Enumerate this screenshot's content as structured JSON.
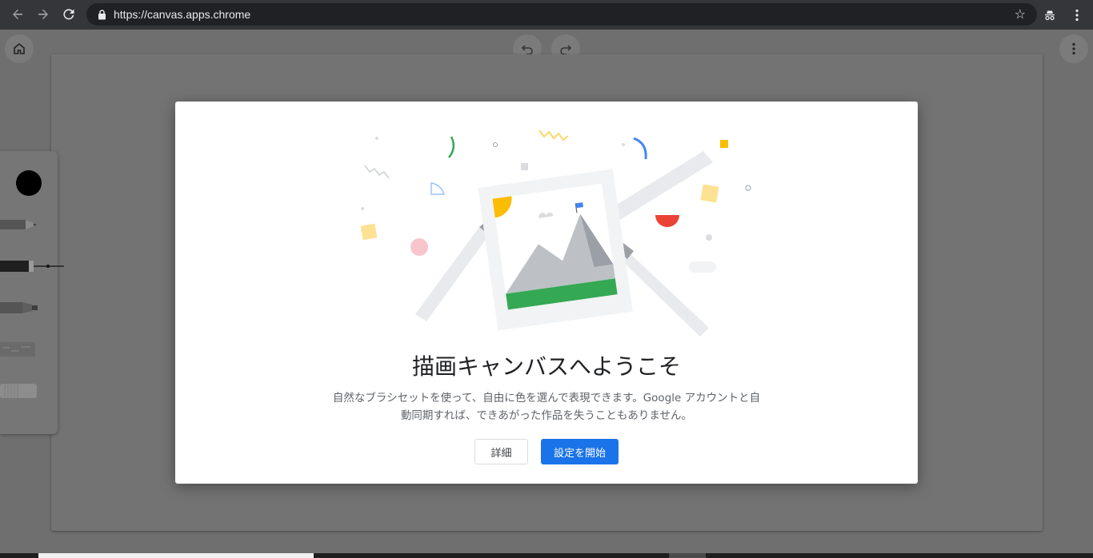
{
  "browser": {
    "url": "https://canvas.apps.chrome"
  },
  "colors": {
    "primary_button": "#1a73e8",
    "overlay": "#6f6f6f",
    "ink": "#000000"
  },
  "icons": {
    "back": "arrow-left-icon",
    "forward": "arrow-right-icon",
    "reload": "reload-icon",
    "lock": "lock-icon",
    "star": "star-icon",
    "incognito": "incognito-icon",
    "menu": "more-vert-icon",
    "home": "home-icon",
    "undo": "undo-icon",
    "redo": "redo-icon"
  },
  "tools": [
    "color-swatch",
    "pencil",
    "pen",
    "marker",
    "chalk",
    "eraser"
  ],
  "welcome": {
    "title": "描画キャンバスへようこそ",
    "description_line1": "自然なブラシセットを使って、自由に色を選んで表現できます。Google アカウントと自",
    "description_line2": "動同期すれば、できあがった作品を失うこともありません。",
    "details_button": "詳細",
    "start_button": "設定を開始"
  }
}
